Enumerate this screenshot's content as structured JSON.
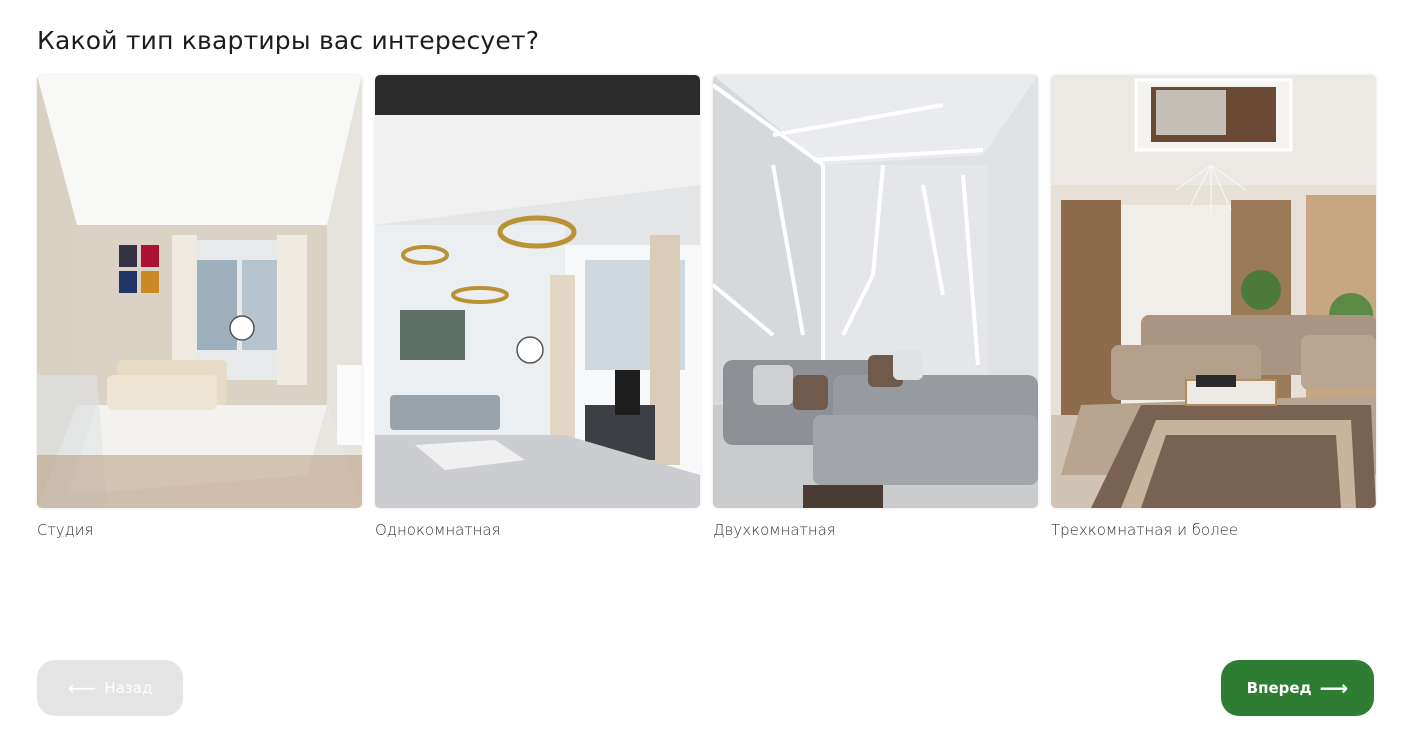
{
  "question": "Какой тип квартиры вас интересует?",
  "options": [
    {
      "label": "Студия"
    },
    {
      "label": "Однокомнатная"
    },
    {
      "label": "Двухкомнатная"
    },
    {
      "label": "Трехкомнатная и более"
    }
  ],
  "nav": {
    "back_label": "Назад",
    "next_label": "Вперед",
    "back_arrow": "⟵",
    "next_arrow": "⟶"
  },
  "colors": {
    "accent": "#2f7d32",
    "disabled": "#e4e4e4"
  }
}
